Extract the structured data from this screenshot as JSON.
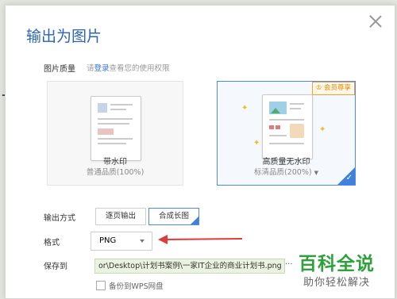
{
  "dialog": {
    "title": "输出为图片",
    "quality_label": "图片质量",
    "hint_prefix": "请",
    "hint_link": "登录",
    "hint_suffix": "查看您的使用权限",
    "options": [
      {
        "title": "带水印",
        "subtitle": "普通品质(100%)"
      },
      {
        "title": "高质量无水印",
        "subtitle": "标清品质(200%)",
        "badge": "会员尊享",
        "selected": true
      }
    ],
    "output_label": "输出方式",
    "output_modes": [
      "逐页输出",
      "合成长图"
    ],
    "format_label": "格式",
    "format_value": "PNG",
    "save_label": "保存到",
    "save_path": "or\\Desktop\\计划书案例\\一家IT企业的商业计划书.png",
    "browse": "...",
    "backup_label": "备份到WPS网盘"
  },
  "watermark": {
    "line1": "百科全说",
    "line2": "助你轻松解决"
  },
  "colors": {
    "accent": "#3f82dd",
    "title": "#2b64b5",
    "annotation_red": "#e03a3a",
    "watermark_green": "#2da23a"
  }
}
